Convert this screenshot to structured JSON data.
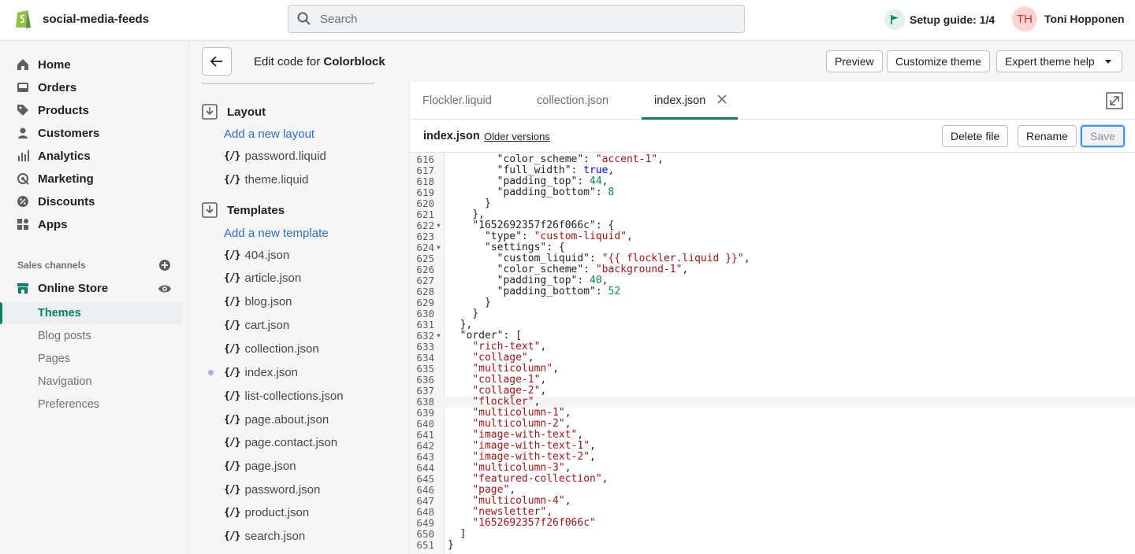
{
  "topbar": {
    "store_name": "social-media-feeds",
    "search_placeholder": "Search",
    "setup_guide": "Setup guide: 1/4",
    "avatar_initials": "TH",
    "user_name": "Toni Hopponen"
  },
  "nav": {
    "items": [
      "Home",
      "Orders",
      "Products",
      "Customers",
      "Analytics",
      "Marketing",
      "Discounts",
      "Apps"
    ],
    "sales_channels_label": "Sales channels",
    "online_store": "Online Store",
    "sub_items": [
      "Themes",
      "Blog posts",
      "Pages",
      "Navigation",
      "Preferences"
    ]
  },
  "editor": {
    "title_prefix": "Edit code for",
    "theme_name": "Colorblock",
    "preview_label": "Preview",
    "customize_label": "Customize theme",
    "help_label": "Expert theme help"
  },
  "files": {
    "layout_label": "Layout",
    "add_layout": "Add a new layout",
    "layout_files": [
      "password.liquid",
      "theme.liquid"
    ],
    "templates_label": "Templates",
    "add_template": "Add a new template",
    "template_files": [
      "404.json",
      "article.json",
      "blog.json",
      "cart.json",
      "collection.json",
      "index.json",
      "list-collections.json",
      "page.about.json",
      "page.contact.json",
      "page.json",
      "password.json",
      "product.json",
      "search.json"
    ]
  },
  "tabs": [
    "Flockler.liquid",
    "collection.json",
    "index.json"
  ],
  "filebar": {
    "file_name": "index.json",
    "older_versions": "Older versions",
    "delete_label": "Delete file",
    "rename_label": "Rename",
    "save_label": "Save"
  },
  "code_lines": [
    {
      "n": "616",
      "t": "        \"color_scheme\": \"accent-1\","
    },
    {
      "n": "617",
      "t": "        \"full_width\": true,"
    },
    {
      "n": "618",
      "t": "        \"padding_top\": 44,"
    },
    {
      "n": "619",
      "t": "        \"padding_bottom\": 8"
    },
    {
      "n": "620",
      "t": "      }"
    },
    {
      "n": "621",
      "t": "    },"
    },
    {
      "n": "622",
      "t": "    \"1652692357f26f066c\": {",
      "fold": true
    },
    {
      "n": "623",
      "t": "      \"type\": \"custom-liquid\","
    },
    {
      "n": "624",
      "t": "      \"settings\": {",
      "fold": true
    },
    {
      "n": "625",
      "t": "        \"custom_liquid\": \"{{ flockler.liquid }}\","
    },
    {
      "n": "626",
      "t": "        \"color_scheme\": \"background-1\","
    },
    {
      "n": "627",
      "t": "        \"padding_top\": 40,"
    },
    {
      "n": "628",
      "t": "        \"padding_bottom\": 52"
    },
    {
      "n": "629",
      "t": "      }"
    },
    {
      "n": "630",
      "t": "    }"
    },
    {
      "n": "631",
      "t": "  },"
    },
    {
      "n": "632",
      "t": "  \"order\": [",
      "fold": true
    },
    {
      "n": "633",
      "t": "    \"rich-text\","
    },
    {
      "n": "634",
      "t": "    \"collage\","
    },
    {
      "n": "635",
      "t": "    \"multicolumn\","
    },
    {
      "n": "636",
      "t": "    \"collage-1\","
    },
    {
      "n": "637",
      "t": "    \"collage-2\","
    },
    {
      "n": "638",
      "t": "    \"flockler\",",
      "hl": true
    },
    {
      "n": "639",
      "t": "    \"multicolumn-1\","
    },
    {
      "n": "640",
      "t": "    \"multicolumn-2\","
    },
    {
      "n": "641",
      "t": "    \"image-with-text\","
    },
    {
      "n": "642",
      "t": "    \"image-with-text-1\","
    },
    {
      "n": "643",
      "t": "    \"image-with-text-2\","
    },
    {
      "n": "644",
      "t": "    \"multicolumn-3\","
    },
    {
      "n": "645",
      "t": "    \"featured-collection\","
    },
    {
      "n": "646",
      "t": "    \"page\","
    },
    {
      "n": "647",
      "t": "    \"multicolumn-4\","
    },
    {
      "n": "648",
      "t": "    \"newsletter\","
    },
    {
      "n": "649",
      "t": "    \"1652692357f26f066c\""
    },
    {
      "n": "650",
      "t": "  ]"
    },
    {
      "n": "651",
      "t": "}"
    }
  ]
}
